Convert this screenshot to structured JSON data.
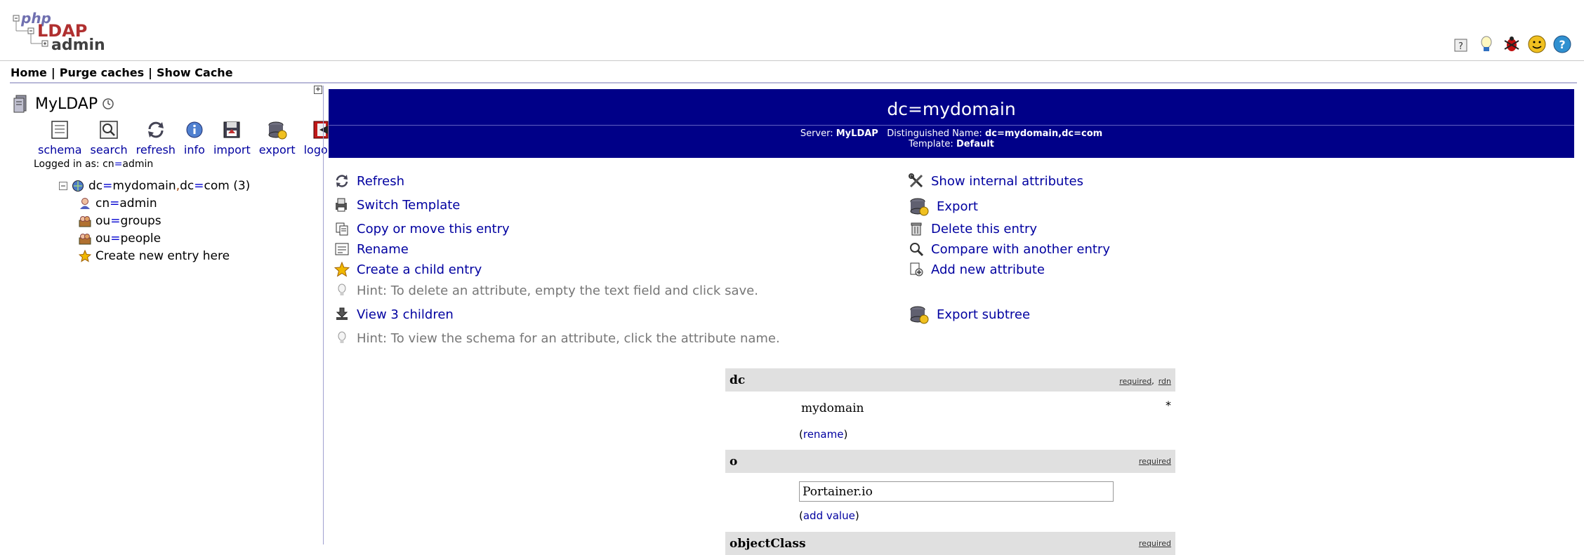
{
  "logo": {
    "line1": "php",
    "line2": "LDAP",
    "line3": "admin"
  },
  "help_icons": [
    "help-icon",
    "hint-bulb-icon",
    "bug-icon",
    "smiley-icon",
    "info-question-icon"
  ],
  "topmenu": {
    "home": "Home",
    "purge": "Purge caches",
    "show_cache": "Show Cache",
    "sep": "|"
  },
  "sidebar": {
    "server_name": "MyLDAP",
    "icons": [
      {
        "label": "schema"
      },
      {
        "label": "search"
      },
      {
        "label": "refresh"
      },
      {
        "label": "info"
      },
      {
        "label": "import"
      },
      {
        "label": "export"
      },
      {
        "label": "logout"
      }
    ],
    "logged_in_prefix": "Logged in as:",
    "logged_in_user": "cn",
    "logged_in_user_val": "admin",
    "tree": {
      "root_a": "dc",
      "root_a_val": "mydomain",
      "root_b": "dc",
      "root_b_val": "com",
      "root_count": "(3)",
      "children": [
        {
          "attr": "cn",
          "val": "admin"
        },
        {
          "attr": "ou",
          "val": "groups"
        },
        {
          "attr": "ou",
          "val": "people"
        }
      ],
      "create": "Create new entry here"
    }
  },
  "banner": {
    "dn": "dc=mydomain",
    "server_label": "Server:",
    "server_value": "MyLDAP",
    "dn_label": "Distinguished Name:",
    "dn_value": "dc=mydomain,dc=com",
    "template_label": "Template:",
    "template_value": "Default"
  },
  "actions": {
    "refresh": "Refresh",
    "switch_template": "Switch Template",
    "copy_move": "Copy or move this entry",
    "rename": "Rename",
    "create_child": "Create a child entry",
    "hint_delete": "Hint: To delete an attribute, empty the text field and click save.",
    "view_children": "View 3 children",
    "hint_schema": "Hint: To view the schema for an attribute, click the attribute name.",
    "show_internal": "Show internal attributes",
    "export": "Export",
    "delete": "Delete this entry",
    "compare": "Compare with another entry",
    "add_attribute": "Add new attribute",
    "export_subtree": "Export subtree"
  },
  "attributes": {
    "dc": {
      "name": "dc",
      "notes_required": "required",
      "notes_comma": ",",
      "notes_rdn": "rdn",
      "value": "mydomain",
      "star": "*",
      "link": "rename"
    },
    "o": {
      "name": "o",
      "notes": "required",
      "value": "Portainer.io",
      "link": "add value"
    },
    "objectclass": {
      "name": "objectClass",
      "notes": "required"
    }
  },
  "colors": {
    "banner": "#000088",
    "link": "#0000a0",
    "attr_header": "#e0e0e0"
  }
}
